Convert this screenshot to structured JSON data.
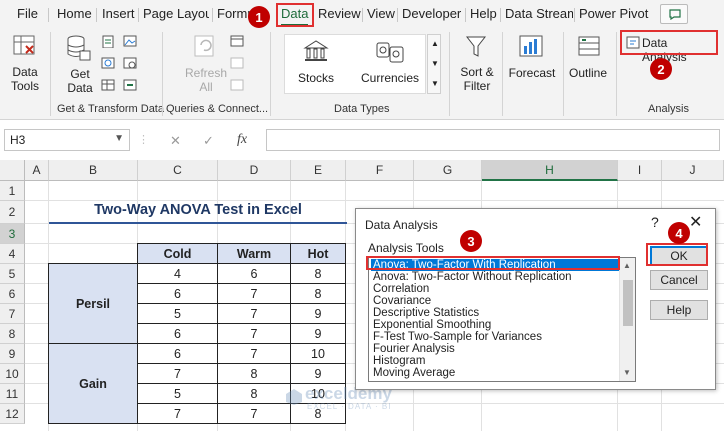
{
  "menu": {
    "tabs": [
      "File",
      "Home",
      "Insert",
      "Page Layout",
      "Formu",
      "Data",
      "Review",
      "View",
      "Developer",
      "Help",
      "Data Stream",
      "Power Pivot"
    ],
    "active": "Data"
  },
  "ribbon": {
    "data_tools_label": "Data\nTools",
    "get_data_label": "Get\nData",
    "get_transform_group": "Get & Transform Data",
    "refresh_all_label": "Refresh\nAll",
    "queries_group": "Queries & Connect...",
    "stocks_label": "Stocks",
    "currencies_label": "Currencies",
    "data_types_group": "Data Types",
    "sort_filter_label": "Sort &\nFilter",
    "forecast_label": "Forecast",
    "outline_label": "Outline",
    "data_analysis_label": "Data Analysis",
    "analysis_group": "Analysis"
  },
  "formula_bar": {
    "name_box": "H3",
    "cancel_symbol": "✕",
    "enter_symbol": "✓",
    "fx_label": "fx",
    "formula": ""
  },
  "sheet": {
    "columns": [
      "A",
      "B",
      "C",
      "D",
      "E",
      "F",
      "G",
      "H",
      "I",
      "J"
    ],
    "selected_column": "H",
    "rows": [
      "1",
      "2",
      "3",
      "4",
      "5",
      "6",
      "7",
      "8",
      "9",
      "10",
      "11",
      "12"
    ],
    "selected_row": "3",
    "title": "Two-Way ANOVA Test in Excel",
    "table": {
      "headers": [
        "Cold",
        "Warm",
        "Hot"
      ],
      "groups": [
        {
          "name": "Persil",
          "rows": [
            [
              "4",
              "6",
              "8"
            ],
            [
              "6",
              "7",
              "8"
            ],
            [
              "5",
              "7",
              "9"
            ],
            [
              "6",
              "7",
              "9"
            ]
          ]
        },
        {
          "name": "Gain",
          "rows": [
            [
              "6",
              "7",
              "10"
            ],
            [
              "7",
              "8",
              "9"
            ],
            [
              "5",
              "8",
              "10"
            ],
            [
              "7",
              "7",
              "8"
            ]
          ]
        }
      ]
    }
  },
  "dialog": {
    "title": "Data Analysis",
    "help": "?",
    "close": "✕",
    "tools_label": "Analysis Tools",
    "items": [
      "Anova: Two-Factor With Replication",
      "Anova: Two-Factor Without Replication",
      "Correlation",
      "Covariance",
      "Descriptive Statistics",
      "Exponential Smoothing",
      "F-Test Two-Sample for Variances",
      "Fourier Analysis",
      "Histogram",
      "Moving Average"
    ],
    "selected_index": 0,
    "ok": "OK",
    "cancel": "Cancel",
    "help_btn": "Help"
  },
  "callouts": [
    "1",
    "2",
    "3",
    "4"
  ],
  "watermark": {
    "name": "exceldemy",
    "sub": "EXCEL · DATA · BI"
  },
  "colors": {
    "accent": "#217346",
    "callout": "#c00000",
    "table_header": "#d9e1f2",
    "selection": "#0078d7"
  }
}
